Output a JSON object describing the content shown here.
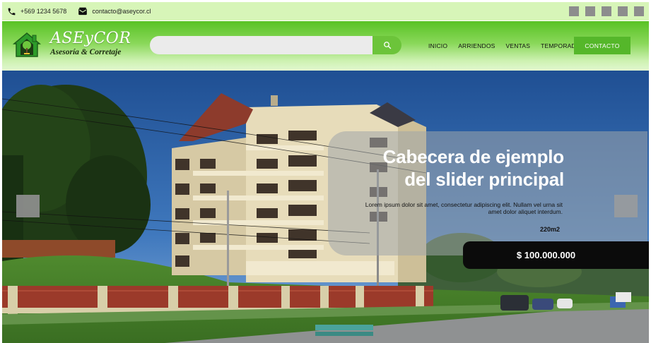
{
  "topbar": {
    "phone": "+569 1234 5678",
    "email": "contacto@aseycor.cl",
    "social_icons": [
      "social-icon-1",
      "social-icon-2",
      "social-icon-3",
      "social-icon-4",
      "social-icon-5"
    ]
  },
  "header": {
    "brand_name": "ASEyCOR",
    "brand_tagline": "Asesoría & Corretaje",
    "search": {
      "value": "",
      "placeholder": ""
    },
    "nav": [
      "INICIO",
      "ARRIENDOS",
      "VENTAS",
      "TEMPORADA"
    ],
    "contact_label": "CONTACTO"
  },
  "slider": {
    "title_line1": "Cabecera de ejemplo",
    "title_line2": "del slider principal",
    "description": "Lorem ipsum dolor sit amet, consectetur adipiscing elit. Nullam vel urna sit amet dolor aliquet interdum.",
    "area": "220m2",
    "price": "$ 100.000.000"
  },
  "colors": {
    "topbar_bg": "#d7f5b8",
    "header_green": "#58c224",
    "search_button": "#6cc43a",
    "contact_button": "#55b72a",
    "price_bar": "#0b0b0b"
  }
}
